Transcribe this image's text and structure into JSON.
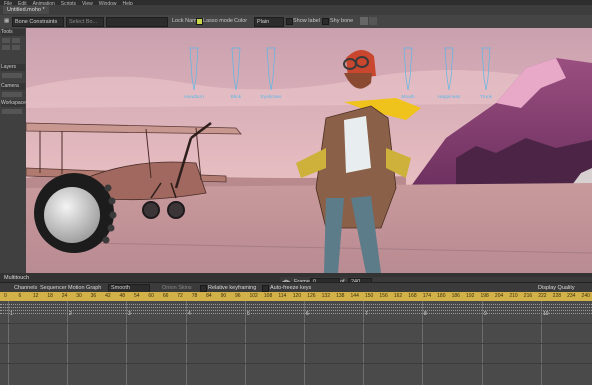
{
  "menubar": {
    "items": [
      "File",
      "Edit",
      "Animation",
      "Scripts",
      "View",
      "Window",
      "Help"
    ]
  },
  "document": {
    "tab_label": "Untitled.moho *"
  },
  "tool_options": {
    "tool_name": "Bone Constraints",
    "select_placeholder": "Select Bo...",
    "lock_label": "Lock Name",
    "lasso_label": "Lasso mode",
    "color_label": "Color",
    "color_value": "Plain",
    "show_label_text": "Show label",
    "shy_label": "Shy bone"
  },
  "left_panel": {
    "sections": [
      "Tools",
      "Layers",
      "Camera",
      "Workspace"
    ]
  },
  "canvas": {
    "sliders": [
      {
        "label": "Headturn"
      },
      {
        "label": "Blink"
      },
      {
        "label": "Eyebrows"
      },
      {
        "label": "Mouth"
      },
      {
        "label": "Happiness"
      },
      {
        "label": "Trunk"
      }
    ]
  },
  "frame_bar": {
    "frame_label": "Frame",
    "frame_value": "0",
    "of_label": "of",
    "end_value": "240",
    "display_quality": "Display Quality"
  },
  "timeline": {
    "panel_title": "Multitouch",
    "tabs": [
      "Channels",
      "Sequencer",
      "Motion Graph"
    ],
    "interp_value": "Smooth",
    "onion_label": "Onion Skins",
    "relative_label": "Relative keyframing",
    "autofreeze_label": "Auto-freeze keys",
    "ruler_numbers": [
      "0",
      "6",
      "12",
      "18",
      "24",
      "30",
      "36",
      "42",
      "48",
      "54",
      "60",
      "66",
      "72",
      "78",
      "84",
      "90",
      "96",
      "102",
      "108",
      "114",
      "120",
      "126",
      "132",
      "138",
      "144",
      "150",
      "156",
      "162",
      "168",
      "174",
      "180",
      "186",
      "192",
      "198",
      "204",
      "210",
      "216",
      "222",
      "228",
      "234",
      "240"
    ],
    "section_numbers": [
      "1",
      "2",
      "3",
      "4",
      "5",
      "6",
      "7",
      "8",
      "9",
      "10"
    ]
  },
  "colors": {
    "accent": "#c8d84a",
    "ruler": "#d2b148",
    "slider": "#5bb8e8"
  }
}
